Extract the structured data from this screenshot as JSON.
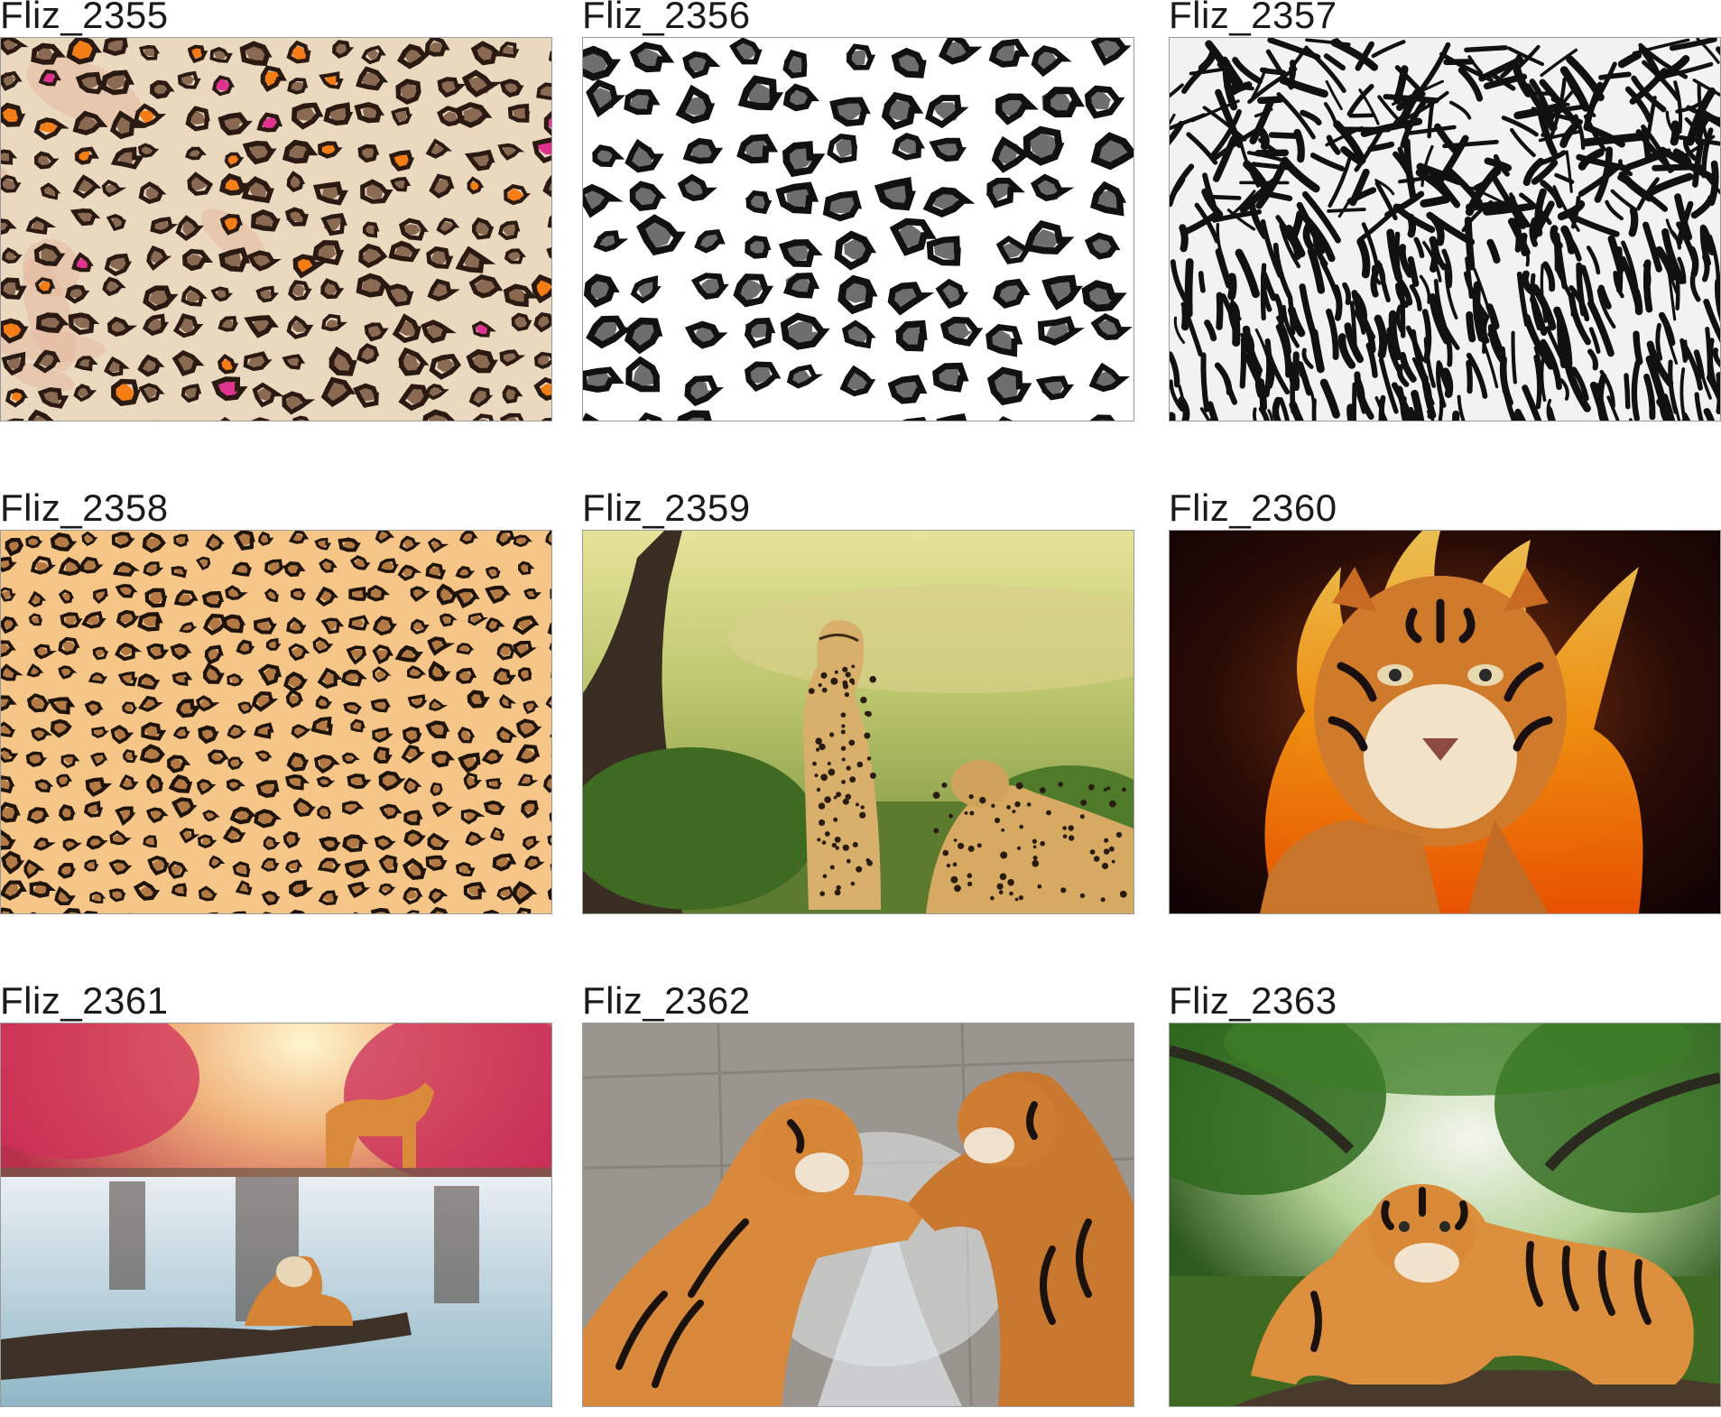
{
  "gallery": {
    "items": [
      {
        "label": "Fliz_2355",
        "image": "leopard-print-pink-orange-pattern"
      },
      {
        "label": "Fliz_2356",
        "image": "black-grey-leopard-print-pattern"
      },
      {
        "label": "Fliz_2357",
        "image": "black-white-tiger-leopard-fur-pattern"
      },
      {
        "label": "Fliz_2358",
        "image": "classic-leopard-print-pattern"
      },
      {
        "label": "Fliz_2359",
        "image": "cheetahs-in-savanna-photo"
      },
      {
        "label": "Fliz_2360",
        "image": "tiger-in-flames-artwork"
      },
      {
        "label": "Fliz_2361",
        "image": "tigers-at-waterfall-photo"
      },
      {
        "label": "Fliz_2362",
        "image": "tigers-fighting-in-water-photo"
      },
      {
        "label": "Fliz_2363",
        "image": "tiger-resting-in-jungle-photo"
      }
    ]
  },
  "colors": {
    "label_text": "#1a1a1a",
    "thumb_border": "#9a9a9a",
    "page_background": "#ffffff"
  }
}
